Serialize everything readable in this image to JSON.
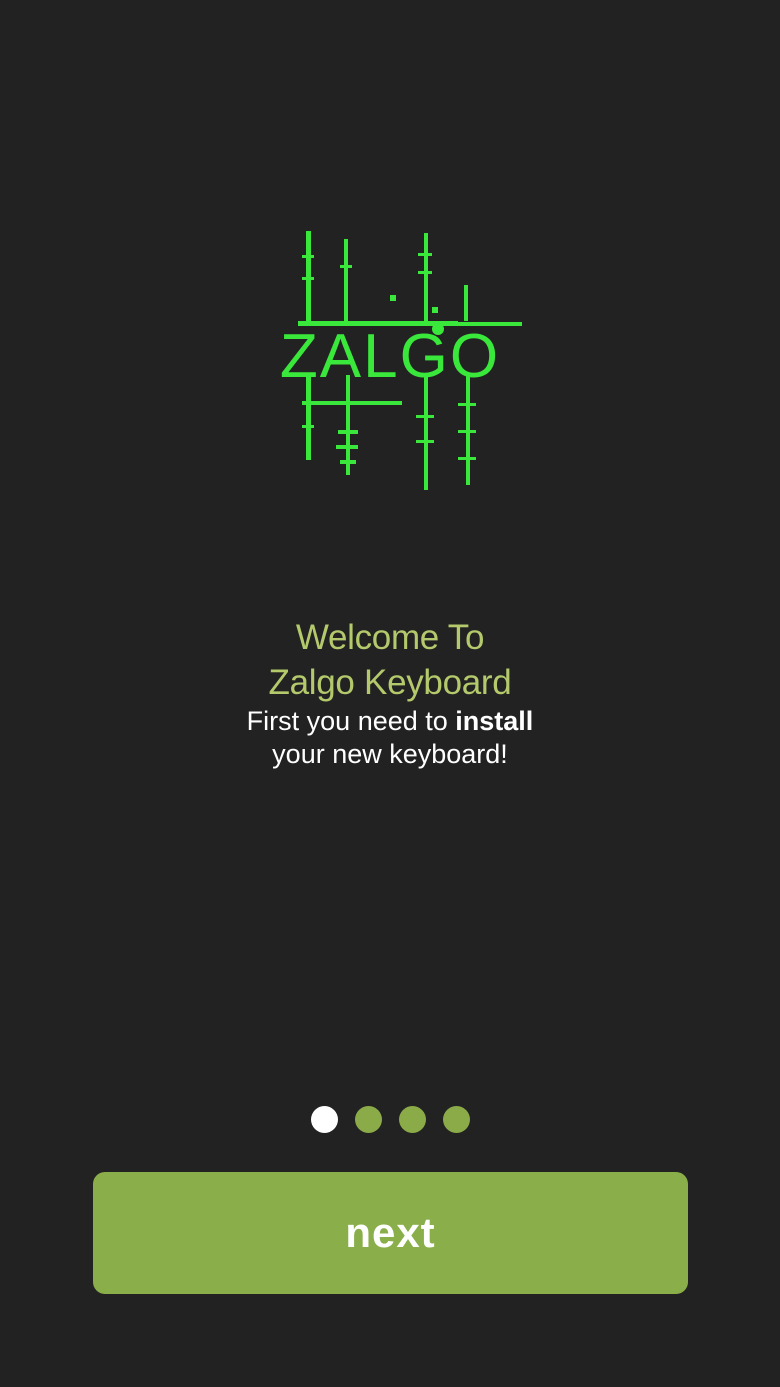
{
  "app": {
    "logo_text": "ZALGO",
    "accent_color": "#8aaf4a",
    "logo_color": "#39e83a"
  },
  "welcome": {
    "title_line1": "Welcome To",
    "title_line2": "Zalgo Keyboard",
    "sub_prefix": "First you need to ",
    "sub_bold": "install",
    "sub_line2": "your new keyboard!"
  },
  "pager": {
    "total": 4,
    "current": 1
  },
  "actions": {
    "next_label": "next"
  }
}
